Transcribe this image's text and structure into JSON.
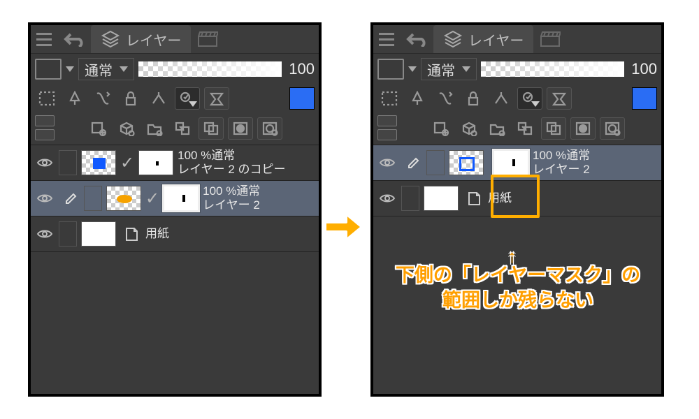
{
  "tabs": {
    "layers_label": "レイヤー"
  },
  "blend": {
    "mode": "通常",
    "opacity": "100"
  },
  "left": {
    "layers": [
      {
        "info": "100 %通常",
        "name": "レイヤー 2 のコピー"
      },
      {
        "info": "100 %通常",
        "name": "レイヤー 2"
      },
      {
        "paper": "用紙"
      }
    ]
  },
  "right": {
    "layers": [
      {
        "info": "100 %通常",
        "name": "レイヤー 2"
      },
      {
        "paper": "用紙"
      }
    ]
  },
  "arrow_pointer": "↑",
  "caption_line1": "下側の「レイヤーマスク」の",
  "caption_line2": "範囲しか残らない"
}
